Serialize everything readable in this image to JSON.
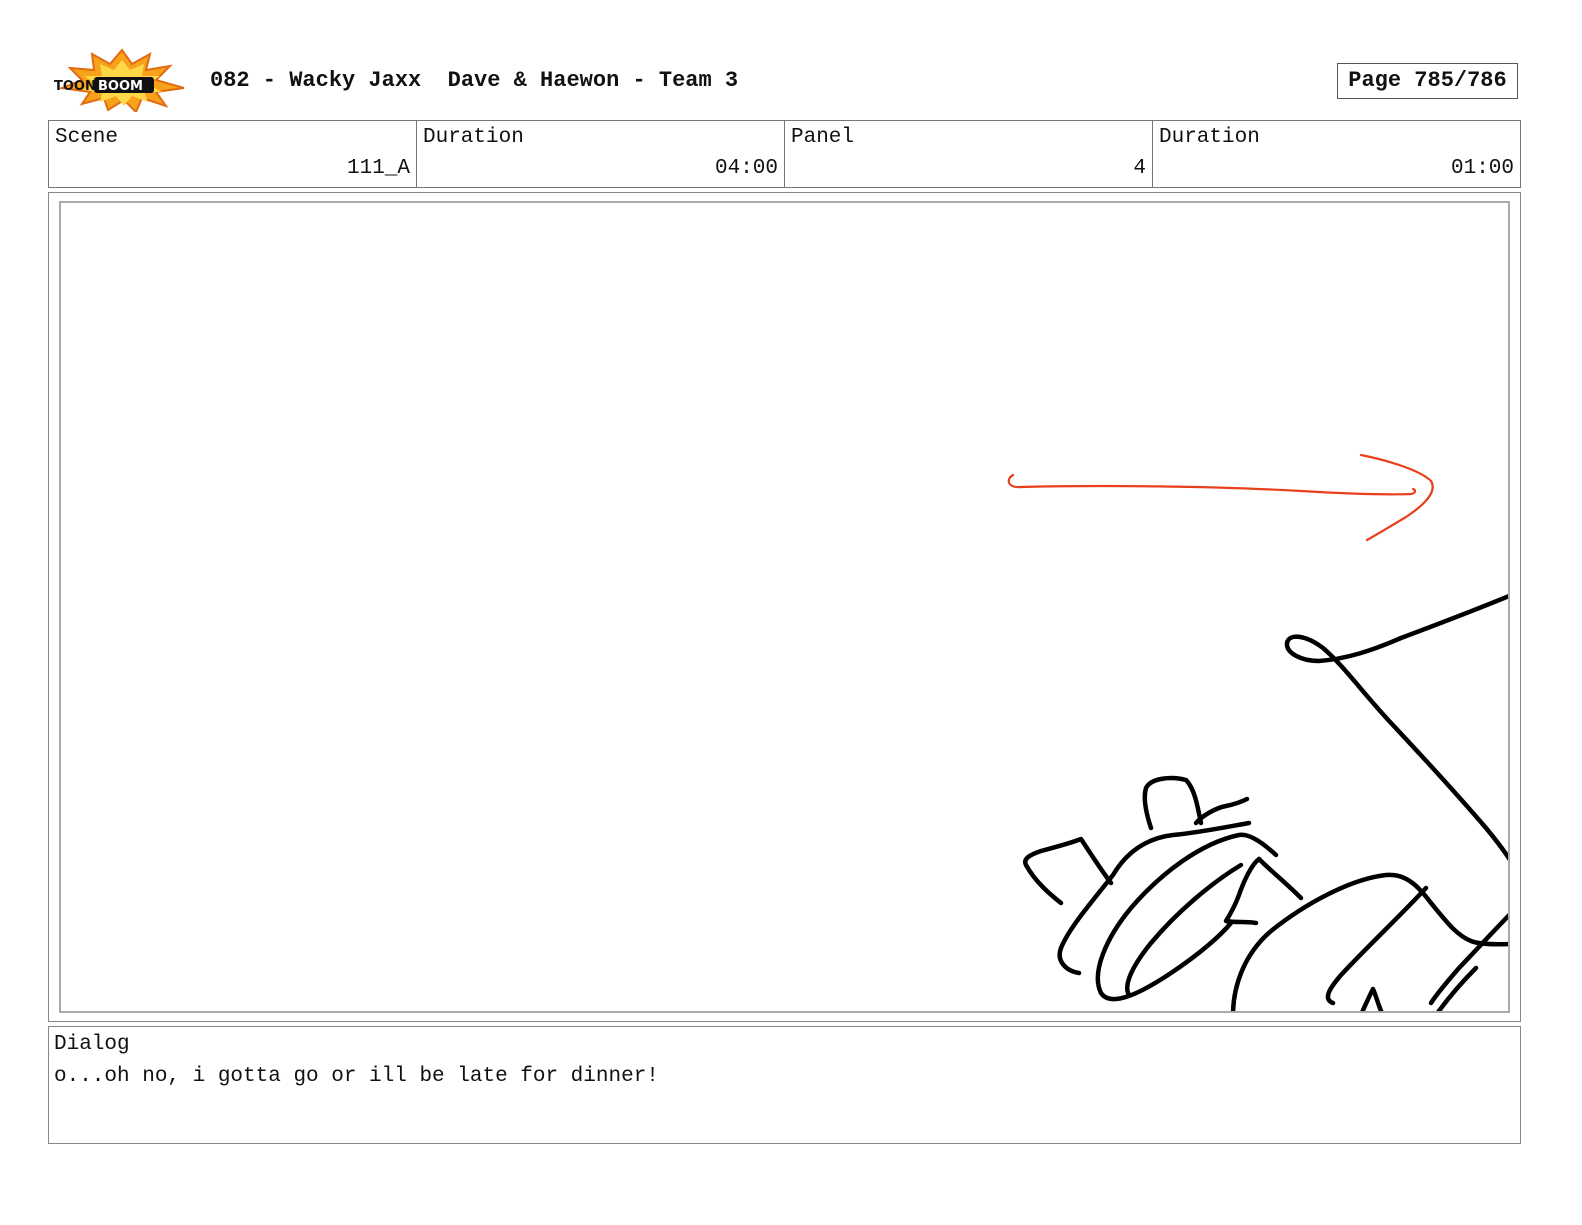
{
  "header": {
    "logo_text": "TOON BOOM",
    "title": "082 - Wacky Jaxx  Dave & Haewon - Team 3",
    "page": "Page 785/786"
  },
  "info": {
    "scene_label": "Scene",
    "scene_value": "111_A",
    "scene_duration_label": "Duration",
    "scene_duration_value": "04:00",
    "panel_label": "Panel",
    "panel_value": "4",
    "panel_duration_label": "Duration",
    "panel_duration_value": "01:00"
  },
  "panel": {
    "sketch_line_color": "#000000",
    "arrow_color": "#e8401c"
  },
  "dialog": {
    "label": "Dialog",
    "text": "o...oh no, i gotta go or ill be late for dinner!"
  }
}
